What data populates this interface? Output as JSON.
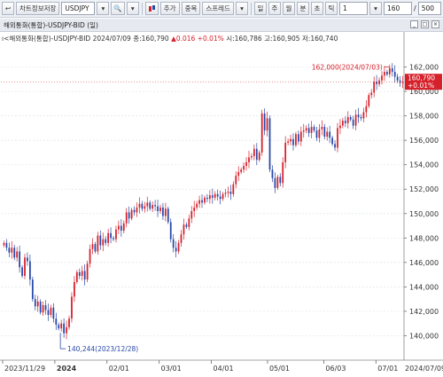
{
  "toolbar": {
    "left_icon": "↩",
    "save_button": "차트정보저장",
    "symbol": "USDJPY",
    "type_icon": "candle-icon",
    "add_button": "추가",
    "overlap_button": "중복",
    "spread_button": "스프레드",
    "periods": [
      "일",
      "주",
      "월",
      "분",
      "초",
      "틱"
    ],
    "interval_value": "1",
    "count_value": "160",
    "count_total": "500"
  },
  "window": {
    "title": "해외통화(통합)-USDJPY-BID (일)"
  },
  "legend": {
    "name": "해외통화(통합)-USDJPY-BID",
    "date": "2024/07/09",
    "close_label": "종:160,790",
    "change": "▲0.016",
    "change_pct": "+0.01%",
    "open": "시:160,786",
    "high": "고:160,905",
    "low": "저:160,740"
  },
  "chart_data": {
    "type": "candlestick",
    "y_axis": {
      "min": 138,
      "max": 164,
      "ticks": [
        140,
        142,
        144,
        146,
        148,
        150,
        152,
        154,
        156,
        158,
        160,
        162
      ]
    },
    "x_labels": [
      "2023/11/29",
      "2024",
      "02/01",
      "03/01",
      "04/01",
      "05/01",
      "06/03",
      "07/01"
    ],
    "last_axis_label": "2024/07/09",
    "annotations": {
      "max": "162,000(2024/07/03)",
      "min": "140,244(2023/12/28)",
      "current_price": "160,790",
      "current_pct": "+0.01%"
    },
    "colors": {
      "up": "#d6202a",
      "down": "#2848a8",
      "grid": "#dfe3ea"
    },
    "closes": [
      147.6,
      147.2,
      146.8,
      147.2,
      146.4,
      146.9,
      145.6,
      144.9,
      146.4,
      146.1,
      144.6,
      143.0,
      142.4,
      142.8,
      141.9,
      142.5,
      142.1,
      141.7,
      142.3,
      141.4,
      140.9,
      140.6,
      141.0,
      140.2,
      140.7,
      141.4,
      143.2,
      144.4,
      145.2,
      144.9,
      145.3,
      144.6,
      145.9,
      147.1,
      147.5,
      146.9,
      148.2,
      147.4,
      147.9,
      147.6,
      148.4,
      148.0,
      147.9,
      148.7,
      149.0,
      148.6,
      149.2,
      150.1,
      149.6,
      150.3,
      150.1,
      150.5,
      150.8,
      150.4,
      150.6,
      150.9,
      150.4,
      150.7,
      150.6,
      150.2,
      150.5,
      149.8,
      150.4,
      149.3,
      147.9,
      147.2,
      146.9,
      147.6,
      148.3,
      149.1,
      148.9,
      149.6,
      150.2,
      150.5,
      150.8,
      151.1,
      150.9,
      151.3,
      151.2,
      151.5,
      151.3,
      151.6,
      151.4,
      151.2,
      151.6,
      151.7,
      151.8,
      151.6,
      152.4,
      153.1,
      153.4,
      153.6,
      153.9,
      154.2,
      154.6,
      154.7,
      155.3,
      154.4,
      155.0,
      158.2,
      156.8,
      157.8,
      153.6,
      152.9,
      152.1,
      153.0,
      152.5,
      154.2,
      155.8,
      155.9,
      156.1,
      155.6,
      156.5,
      155.9,
      156.7,
      156.8,
      157.0,
      156.6,
      157.1,
      156.8,
      156.2,
      156.9,
      157.1,
      156.3,
      156.7,
      156.2,
      155.7,
      155.4,
      157.0,
      157.2,
      157.6,
      157.4,
      157.9,
      157.7,
      157.2,
      158.1,
      157.9,
      157.8,
      158.3,
      158.8,
      159.7,
      159.9,
      160.8,
      160.6,
      160.9,
      161.3,
      161.6,
      161.4,
      161.9,
      161.6,
      161.2,
      160.9,
      160.7,
      160.79
    ]
  }
}
